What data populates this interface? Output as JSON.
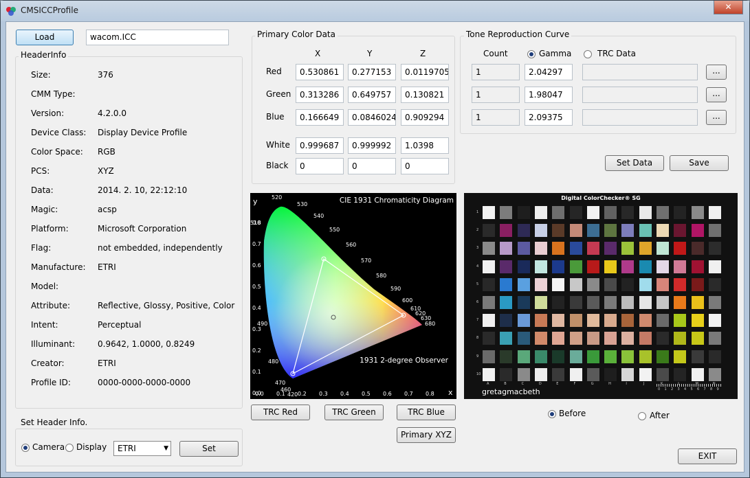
{
  "window": {
    "title": "CMSICCProfile",
    "close_glyph": "✕"
  },
  "file": {
    "load_label": "Load",
    "filename": "wacom.ICC"
  },
  "header_info": {
    "title": "HeaderInfo",
    "rows": [
      {
        "label": "Size:",
        "value": "376"
      },
      {
        "label": "CMM Type:",
        "value": ""
      },
      {
        "label": "Version:",
        "value": "4.2.0.0"
      },
      {
        "label": "Device Class:",
        "value": "Display Device Profile"
      },
      {
        "label": "Color Space:",
        "value": "RGB"
      },
      {
        "label": "PCS:",
        "value": "XYZ"
      },
      {
        "label": "Data:",
        "value": "2014. 2. 10,   22:12:10"
      },
      {
        "label": "Magic:",
        "value": "acsp"
      },
      {
        "label": "Platform:",
        "value": "Microsoft Corporation"
      },
      {
        "label": "Flag:",
        "value": "not embedded, independently"
      },
      {
        "label": "Manufacture:",
        "value": "ETRI"
      },
      {
        "label": "Model:",
        "value": ""
      },
      {
        "label": "Attribute:",
        "value": "Reflective, Glossy, Positive, Color"
      },
      {
        "label": "Intent:",
        "value": "Perceptual"
      },
      {
        "label": "Illuminant:",
        "value": "0.9642,  1.0000,  0.8249"
      },
      {
        "label": "Creator:",
        "value": "ETRI"
      },
      {
        "label": "Profile ID:",
        "value": "0000-0000-0000-0000"
      }
    ]
  },
  "set_header": {
    "title": "Set Header Info.",
    "camera_label": "Camera",
    "display_label": "Display",
    "selected": "Camera",
    "dropdown_value": "ETRI",
    "set_label": "Set"
  },
  "primary": {
    "title": "Primary Color Data",
    "cols": [
      "X",
      "Y",
      "Z"
    ],
    "rows": [
      {
        "label": "Red",
        "values": [
          "0.530861",
          "0.277153",
          "0.0119705"
        ]
      },
      {
        "label": "Green",
        "values": [
          "0.313286",
          "0.649757",
          "0.130821"
        ]
      },
      {
        "label": "Blue",
        "values": [
          "0.166649",
          "0.0846024",
          "0.909294"
        ]
      },
      {
        "label": "White",
        "values": [
          "0.999687",
          "0.999992",
          "1.0398"
        ]
      },
      {
        "label": "Black",
        "values": [
          "0",
          "0",
          "0"
        ]
      }
    ]
  },
  "trc": {
    "title": "Tone Reproduction Curve",
    "count_label": "Count",
    "gamma_label": "Gamma",
    "trcdata_label": "TRC Data",
    "selected": "Gamma",
    "rows": [
      {
        "count": "1",
        "gamma": "2.04297",
        "data": "",
        "browse": "..."
      },
      {
        "count": "1",
        "gamma": "1.98047",
        "data": "",
        "browse": "..."
      },
      {
        "count": "1",
        "gamma": "2.09375",
        "data": "",
        "browse": "..."
      }
    ],
    "set_data_label": "Set Data",
    "save_label": "Save"
  },
  "diagram": {
    "title": "CIE 1931 Chromaticity Diagram",
    "observer": "1931 2-degree Observer",
    "y_axis": "y",
    "x_axis": "x",
    "wavelengths": [
      "520",
      "530",
      "540",
      "550",
      "560",
      "570",
      "580",
      "590",
      "600",
      "610",
      "620",
      "630",
      "680",
      "510",
      "490",
      "480",
      "470",
      "460",
      "420"
    ],
    "xticks": [
      "0.0",
      "0.1",
      "0.2",
      "0.3",
      "0.4",
      "0.5",
      "0.6",
      "0.7",
      "0.8"
    ],
    "yticks": [
      "0.8",
      "0.7",
      "0.6",
      "0.5",
      "0.4",
      "0.3",
      "0.2",
      "0.1",
      "0.0"
    ]
  },
  "checker": {
    "title": "Digital ColorChecker® SG",
    "brand": "gretagmacbeth",
    "cols": [
      "A",
      "B",
      "C",
      "D",
      "E",
      "F",
      "G",
      "H",
      "I",
      "J",
      "K",
      "L",
      "M",
      "N"
    ],
    "rows": [
      "1",
      "2",
      "3",
      "4",
      "5",
      "6",
      "7",
      "8",
      "9",
      "10"
    ],
    "scale": [
      "0",
      "1",
      "2",
      "3",
      "4",
      "5",
      "6",
      "7",
      "8",
      "9"
    ],
    "swatches": [
      [
        "#f2f2f2",
        "#7c7c7c",
        "#1e1e1e",
        "#ededed",
        "#6e6e6e",
        "#262626",
        "#f2f2f2",
        "#616161",
        "#282828",
        "#e9e9e9",
        "#707070",
        "#232323",
        "#8a8a8a",
        "#f0f0f0"
      ],
      [
        "#2a2a2a",
        "#8a1f62",
        "#2e2a55",
        "#c7cfe6",
        "#5a3a28",
        "#c58a78",
        "#3d6e93",
        "#5e7540",
        "#7d7dbb",
        "#6ac1b4",
        "#ecd9b4",
        "#6a1630",
        "#b01565",
        "#707070"
      ],
      [
        "#8a8a8a",
        "#b79ac8",
        "#5c5aa0",
        "#e9cdd2",
        "#d9731e",
        "#2a4a9c",
        "#c43a52",
        "#5a2a6a",
        "#9bc23a",
        "#e0a52a",
        "#bfe6d4",
        "#c01818",
        "#4a2a2a",
        "#2c2c2c"
      ],
      [
        "#f0f0f0",
        "#5a2a6a",
        "#1a2a5a",
        "#c2e6df",
        "#1c3a8c",
        "#4a9a3a",
        "#b81a1a",
        "#e8c81a",
        "#b03a8a",
        "#1a8ab0",
        "#e4d8e8",
        "#d07a96",
        "#a01232",
        "#f0f0f0"
      ],
      [
        "#282828",
        "#2a7ad0",
        "#5aa0e0",
        "#ecd2d6",
        "#f4f4f4",
        "#c8c8c8",
        "#8a8a8a",
        "#4a4a4a",
        "#222222",
        "#a0dcec",
        "#d8857a",
        "#d02a2a",
        "#7a1a1a",
        "#2a2a2a"
      ],
      [
        "#7a7a7a",
        "#2a9ac4",
        "#1a3a5a",
        "#d0dc9a",
        "#222222",
        "#3a3a3a",
        "#5a5a5a",
        "#7a7a7a",
        "#bcbcbc",
        "#e6e6e6",
        "#c6c6c6",
        "#ea7a1a",
        "#eac01a",
        "#7a7a7a"
      ],
      [
        "#f0f0f0",
        "#1e2e4a",
        "#6a9ad8",
        "#c87a56",
        "#e0b8a2",
        "#c0906a",
        "#e0ba9c",
        "#d8aa8e",
        "#a8643a",
        "#d08a6e",
        "#6a6a6a",
        "#a8c81a",
        "#e8d01a",
        "#f0f0f0"
      ],
      [
        "#2a2a2a",
        "#3aa0b4",
        "#2a5a7a",
        "#d28a6a",
        "#e0a694",
        "#d0a088",
        "#c89a86",
        "#d8a294",
        "#dcb0a0",
        "#c47a66",
        "#2a2a2a",
        "#b0b81a",
        "#c8c818",
        "#7a7a7a"
      ],
      [
        "#6a6a6a",
        "#2a3a2a",
        "#5aa87a",
        "#3a8a6a",
        "#1a3a2a",
        "#6aac9a",
        "#3a9a3a",
        "#5ab03a",
        "#8ac23a",
        "#a8c22a",
        "#3a7a1a",
        "#c4c81a",
        "#3a3a3a",
        "#2a2a2a"
      ],
      [
        "#f0f0f0",
        "#2a2a2a",
        "#8a8a8a",
        "#ececec",
        "#3a3a3a",
        "#f0f0f0",
        "#5a5a5a",
        "#1e1e1e",
        "#d6d6d6",
        "#f2f2f2",
        "#4a4a4a",
        "#242424",
        "#f0f0f0",
        "#8a8a8a"
      ]
    ]
  },
  "buttons": {
    "trc_red": "TRC Red",
    "trc_green": "TRC Green",
    "trc_blue": "TRC Blue",
    "primary_xyz": "Primary XYZ",
    "exit": "EXIT"
  },
  "view": {
    "before_label": "Before",
    "after_label": "After",
    "selected": "Before"
  }
}
